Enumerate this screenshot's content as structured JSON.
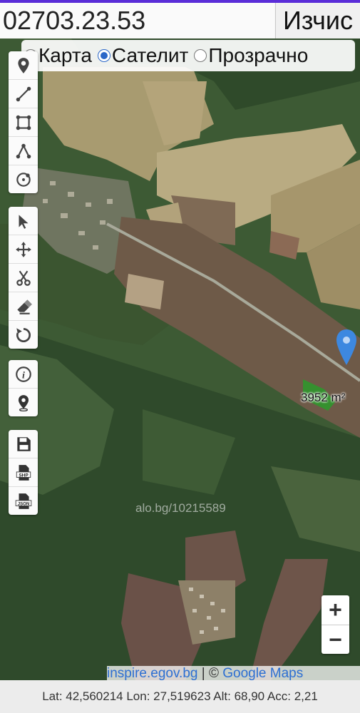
{
  "header": {
    "search_value": "02703.23.53",
    "calc_button_label": "Изчис"
  },
  "layer_switch": {
    "options": [
      {
        "label": "Карта",
        "selected": false
      },
      {
        "label": "Сателит",
        "selected": true
      },
      {
        "label": "Прозрачно",
        "selected": false
      }
    ]
  },
  "tools": {
    "group1": [
      "marker-icon",
      "line-icon",
      "rectangle-icon",
      "polygon-icon",
      "circle-icon"
    ],
    "group2": [
      "cursor-icon",
      "move-icon",
      "scissors-icon",
      "eraser-icon",
      "undo-icon"
    ],
    "group3": [
      "info-icon",
      "location-pin-icon"
    ],
    "group4": [
      "save-icon",
      "shp-export-icon",
      "json-export-icon"
    ],
    "shp_text": "SHP",
    "json_text": "JSON"
  },
  "map": {
    "watermark": "alo.bg/10215589",
    "area_label": "3952 m²",
    "zoom_in_label": "+",
    "zoom_out_label": "−",
    "attribution_source": "inspire.egov.bg",
    "attribution_separator": " | © ",
    "attribution_maps": "Google Maps"
  },
  "status": {
    "text": "Lat: 42,560214 Lon: 27,519623 Alt: 68,90 Acc: 2,21"
  },
  "colors": {
    "accent": "#5a2dd8",
    "radio": "#2a66c8",
    "pin": "#3d88e0",
    "link": "#2d6fd2"
  }
}
